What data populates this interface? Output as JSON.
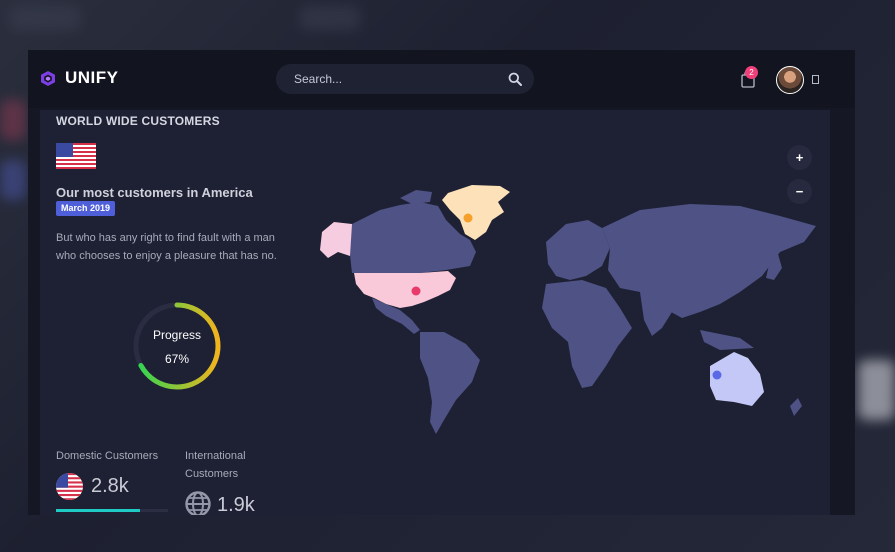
{
  "header": {
    "brand": "UNIFY",
    "search_placeholder": "Search...",
    "cart_count": "2"
  },
  "card": {
    "title": "WORLD WIDE CUSTOMERS",
    "headline": "Our most customers in America",
    "date_badge": "March 2019",
    "description": "But who has any right to find fault with a man who chooses to enjoy a pleasure that has no.",
    "progress": {
      "label": "Progress",
      "value_text": "67%",
      "value": 0.67
    },
    "zoom_in": "+",
    "zoom_out": "−",
    "stats": [
      {
        "label": "Domestic Customers",
        "value": "2.8k",
        "progress": 0.75
      },
      {
        "label": "International Customers",
        "value": "1.9k"
      }
    ]
  },
  "colors": {
    "accent": "#4f5fd9",
    "land": "#4e5285",
    "usa": "#f9c9d9",
    "alaska": "#f6cde0",
    "greenland": "#fde2b9",
    "australia": "#c3c8f6",
    "progress_start": "#2bd653",
    "progress_end": "#f1b51d",
    "teal": "#1ecac2",
    "badge": "#f0407a"
  }
}
